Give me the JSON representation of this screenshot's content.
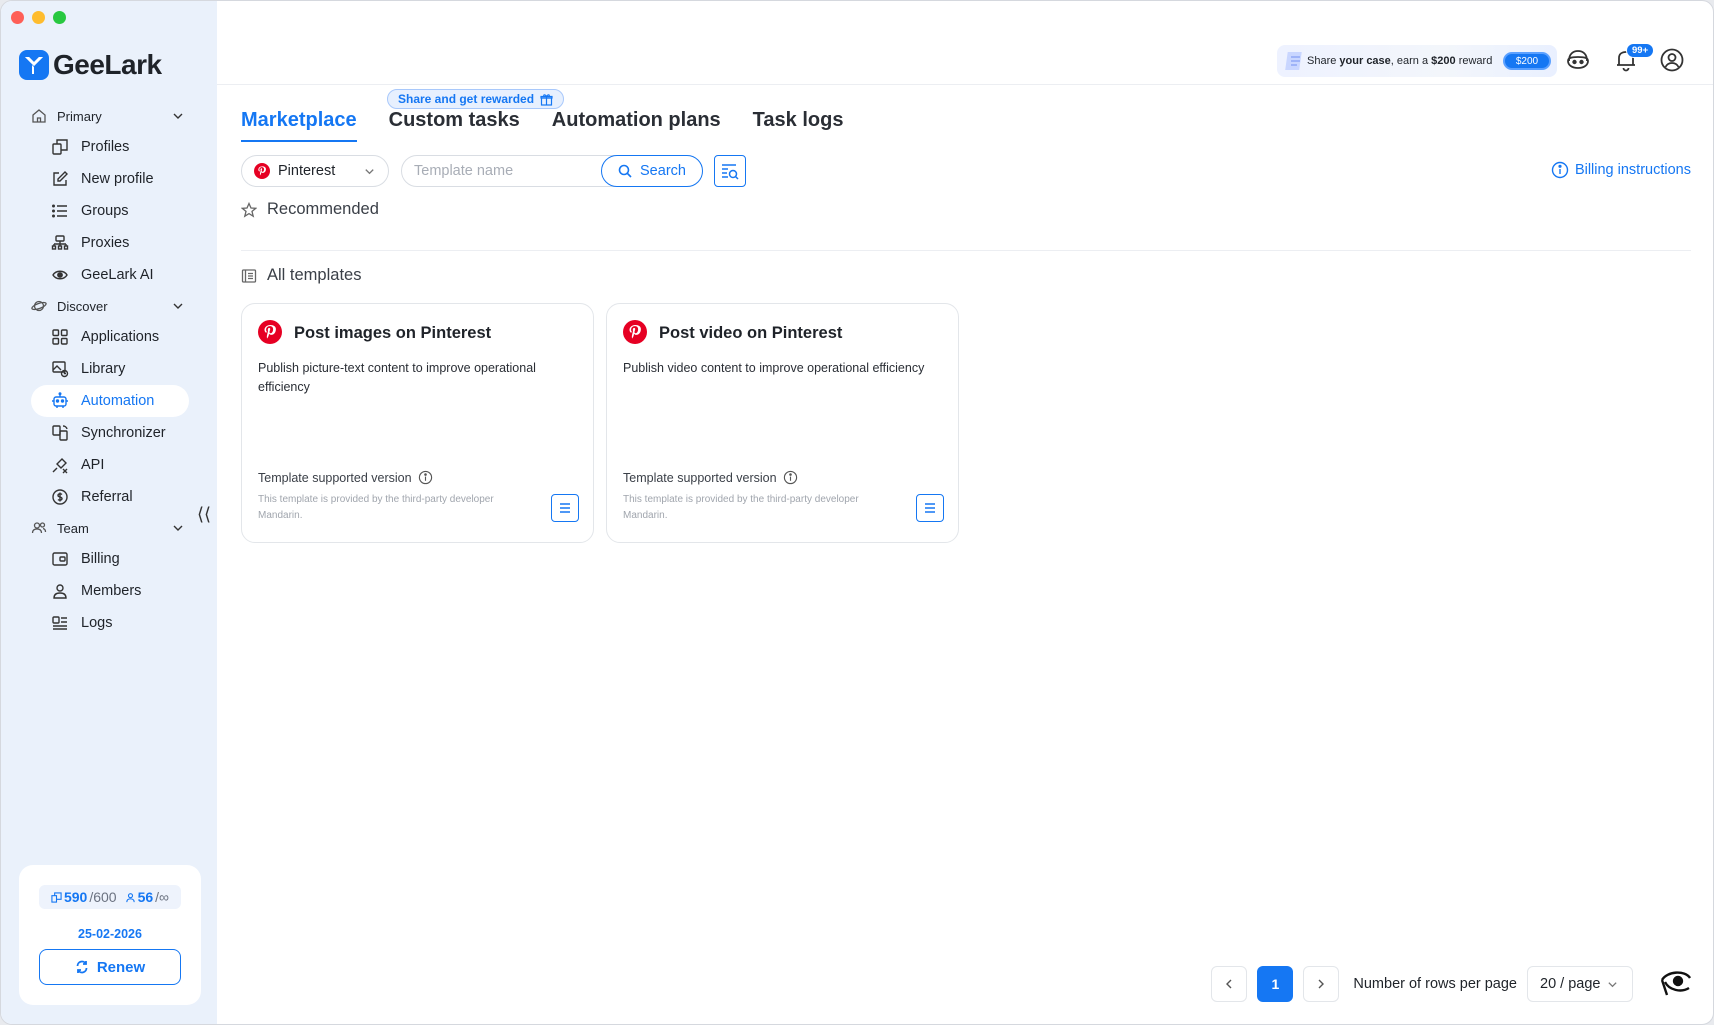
{
  "app": {
    "name": "GeeLark"
  },
  "sidebar": {
    "sections": [
      {
        "label": "Primary",
        "items": [
          "Profiles",
          "New profile",
          "Groups",
          "Proxies",
          "GeeLark AI"
        ]
      },
      {
        "label": "Discover",
        "items": [
          "Applications",
          "Library",
          "Automation",
          "Synchronizer",
          "API",
          "Referral"
        ]
      },
      {
        "label": "Team",
        "items": [
          "Billing",
          "Members",
          "Logs"
        ]
      }
    ],
    "active_item": "Automation",
    "collapse_glyph": "⟨⟨"
  },
  "account": {
    "profiles_used": "590",
    "profiles_total": "/600",
    "members_used": "56",
    "members_total": "/∞",
    "expiry_date": "25-02-2026",
    "renew_label": "Renew"
  },
  "header": {
    "promo_pre": "Share ",
    "promo_bold1": "your case",
    "promo_mid": ", earn a ",
    "promo_bold2": "$200",
    "promo_post": " reward",
    "promo_button": "$200",
    "notification_count": "99+"
  },
  "main": {
    "share_tag": "Share and get rewarded",
    "tabs": [
      "Marketplace",
      "Custom tasks",
      "Automation plans",
      "Task logs"
    ],
    "active_tab": "Marketplace",
    "platform_select": "Pinterest",
    "search_placeholder": "Template name",
    "search_label": "Search",
    "billing_link": "Billing instructions",
    "recommended_label": "Recommended",
    "all_templates_label": "All templates",
    "templates": [
      {
        "title": "Post images on Pinterest",
        "description": "Publish picture-text content to improve operational efficiency",
        "version_label": "Template supported version",
        "note": "This template is provided by the third-party developer Mandarin."
      },
      {
        "title": "Post video on Pinterest",
        "description": "Publish video content to improve operational efficiency",
        "version_label": "Template supported version",
        "note": "This template is provided by the third-party developer Mandarin."
      }
    ]
  },
  "pagination": {
    "current_page": "1",
    "rows_label": "Number of rows per page",
    "page_size": "20 / page"
  },
  "colors": {
    "accent": "#1577f3",
    "sidebar_bg": "#eaf1fb",
    "pinterest": "#e60023"
  }
}
